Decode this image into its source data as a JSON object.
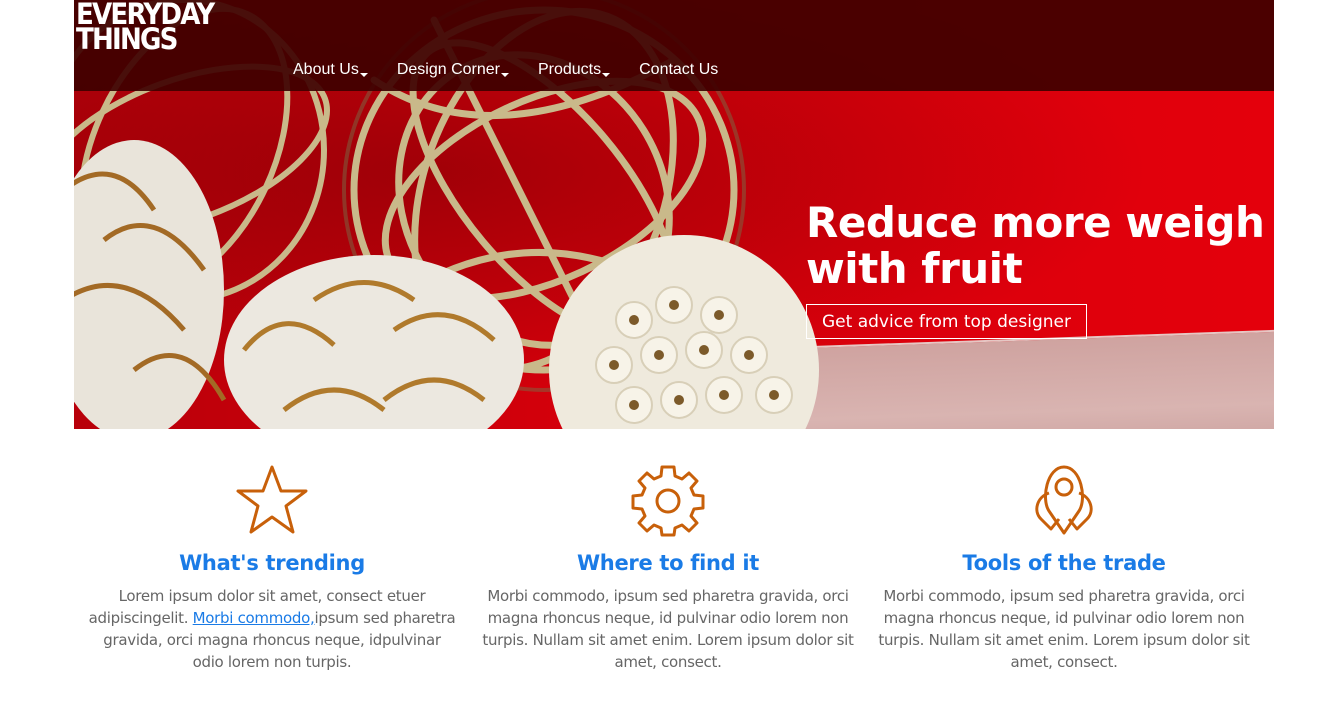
{
  "brand": {
    "line1": "EVERYDAY",
    "line2": "THINGS"
  },
  "nav": {
    "items": [
      {
        "label": "About Us",
        "dropdown": true
      },
      {
        "label": "Design Corner",
        "dropdown": true
      },
      {
        "label": "Products",
        "dropdown": true
      },
      {
        "label": "Contact Us",
        "dropdown": false
      }
    ]
  },
  "hero": {
    "title_line1": "Reduce more weigh",
    "title_line2": "with fruit",
    "button_label": "Get advice from top designer"
  },
  "features": [
    {
      "icon": "star-icon",
      "title": "What's trending",
      "text_before_link": "Lorem ipsum dolor sit amet, consect etuer adipiscingelit. ",
      "link_text": "Morbi commodo,",
      "text_after_link": "ipsum sed pharetra gravida, orci magna rhoncus neque, idpulvinar odio lorem non turpis."
    },
    {
      "icon": "gear-icon",
      "title": "Where to find it",
      "text": "Morbi commodo, ipsum sed pharetra gravida, orci magna rhoncus neque, id pulvinar odio lorem non turpis. Nullam sit amet enim. Lorem ipsum dolor sit amet, consect."
    },
    {
      "icon": "map-pin-icon",
      "title": "Tools of the trade",
      "text": "Morbi commodo, ipsum sed pharetra gravida, orci magna rhoncus neque, id pulvinar odio lorem non turpis. Nullam sit amet enim. Lorem ipsum dolor sit amet, consect."
    }
  ],
  "colors": {
    "accent": "#1a7be6",
    "icon": "#c8600a",
    "navbar": "#3e0000",
    "hero_red": "#d3000b"
  }
}
